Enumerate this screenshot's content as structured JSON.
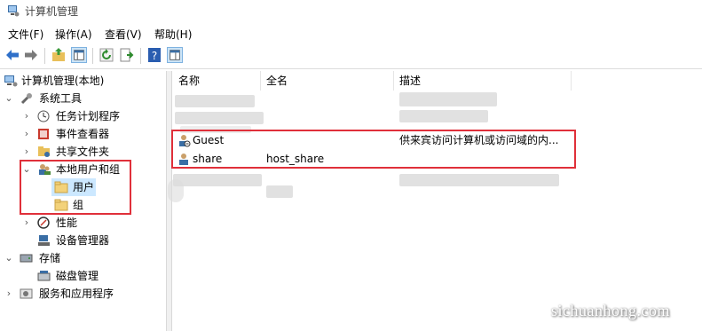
{
  "window": {
    "title": "计算机管理"
  },
  "menu": [
    "文件(F)",
    "操作(A)",
    "查看(V)",
    "帮助(H)"
  ],
  "toolbar_icons": [
    "back-icon",
    "forward-icon",
    "up-folder-icon",
    "show-hide-tree-icon",
    "refresh-icon",
    "export-list-icon",
    "help-icon",
    "properties-pane-icon"
  ],
  "tree": {
    "root": "计算机管理(本地)",
    "system_tools": "系统工具",
    "task_scheduler": "任务计划程序",
    "event_viewer": "事件查看器",
    "shared_folders": "共享文件夹",
    "local_users_groups": "本地用户和组",
    "users": "用户",
    "groups": "组",
    "performance": "性能",
    "device_manager": "设备管理器",
    "storage": "存储",
    "disk_management": "磁盘管理",
    "services_apps": "服务和应用程序"
  },
  "list": {
    "columns": [
      "名称",
      "全名",
      "描述"
    ],
    "rows": [
      {
        "name": "Guest",
        "full_name": "",
        "description": "供来宾访问计算机或访问域的内..."
      },
      {
        "name": "share",
        "full_name": "host_share",
        "description": ""
      }
    ]
  },
  "watermark": "sichuanhong.com",
  "colors": {
    "highlight_box": "#e0303a",
    "selection": "#cce8ff"
  }
}
